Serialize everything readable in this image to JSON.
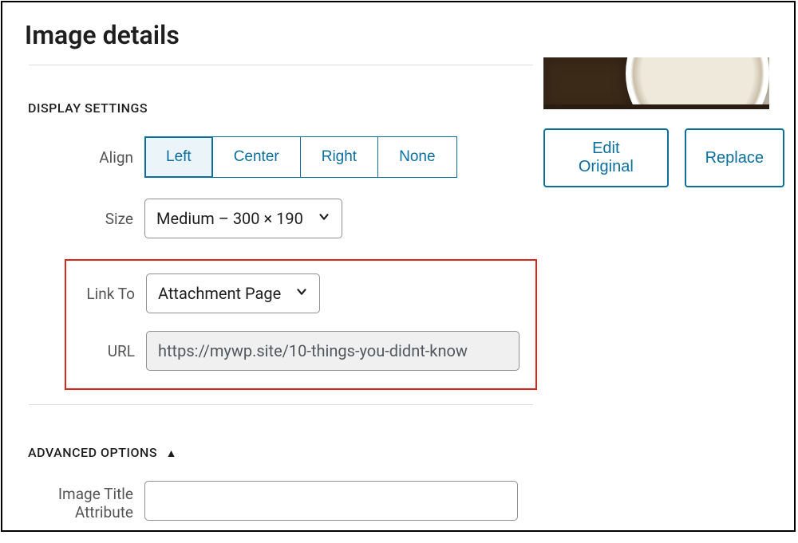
{
  "header": {
    "title": "Image details"
  },
  "sections": {
    "display_settings_heading": "DISPLAY SETTINGS",
    "advanced_options_heading": "ADVANCED OPTIONS"
  },
  "labels": {
    "align": "Align",
    "size": "Size",
    "link_to": "Link To",
    "url": "URL",
    "image_title_attribute_line1": "Image Title",
    "image_title_attribute_line2": "Attribute"
  },
  "align_options": {
    "left": "Left",
    "center": "Center",
    "right": "Right",
    "none": "None"
  },
  "size_select": {
    "value": "Medium – 300 × 190"
  },
  "link_to_select": {
    "value": "Attachment Page"
  },
  "url_field": {
    "value": "https://mywp.site/10-things-you-didnt-know"
  },
  "title_attr_field": {
    "value": ""
  },
  "actions": {
    "edit_original": "Edit Original",
    "replace": "Replace"
  }
}
